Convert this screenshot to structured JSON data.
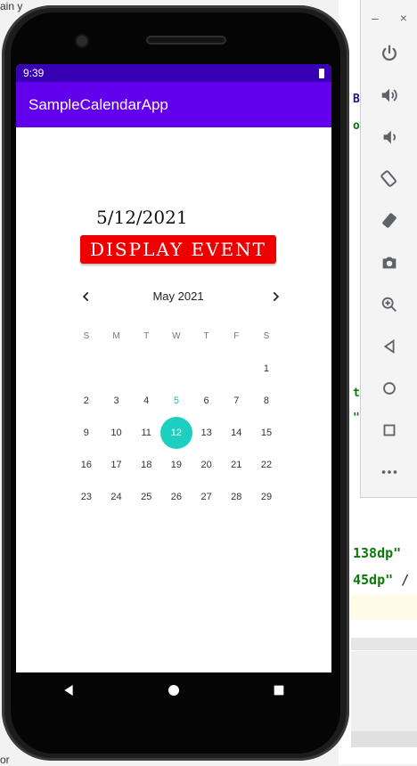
{
  "background": {
    "top_fragment": "ain y",
    "bottom_fragment": "or",
    "code_line_1": "138dp\"",
    "code_line_2": "45dp\"",
    "code_line_2_suffix": "/",
    "fragments": [
      "B",
      "o",
      "t",
      "\""
    ]
  },
  "emulator_panel": {
    "minimize": "–",
    "close": "×",
    "icons": [
      "power-icon",
      "volume-up-icon",
      "volume-down-icon",
      "rotate-left-icon",
      "rotate-right-icon",
      "camera-icon",
      "zoom-icon",
      "back-icon",
      "home-icon",
      "overview-icon",
      "more-icon"
    ]
  },
  "status_bar": {
    "time": "9:39"
  },
  "app_bar": {
    "title": "SampleCalendarApp"
  },
  "content": {
    "date_text": "5/12/2021",
    "event_button": "DISPLAY EVENT"
  },
  "calendar": {
    "month": "May 2021",
    "weekdays": [
      "S",
      "M",
      "T",
      "W",
      "T",
      "F",
      "S"
    ],
    "weeks": [
      [
        "",
        "",
        "",
        "",
        "",
        "",
        "1"
      ],
      [
        "2",
        "3",
        "4",
        "5",
        "6",
        "7",
        "8"
      ],
      [
        "9",
        "10",
        "11",
        "12",
        "13",
        "14",
        "15"
      ],
      [
        "16",
        "17",
        "18",
        "19",
        "20",
        "21",
        "22"
      ],
      [
        "23",
        "24",
        "25",
        "26",
        "27",
        "28",
        "29"
      ]
    ],
    "today": "5",
    "selected": "12",
    "colors": {
      "selected": "#1ccfbf",
      "today": "#20b8a8"
    }
  },
  "colors": {
    "status_bar": "#3700b3",
    "app_bar": "#6200ee",
    "button": "#ee0000"
  }
}
